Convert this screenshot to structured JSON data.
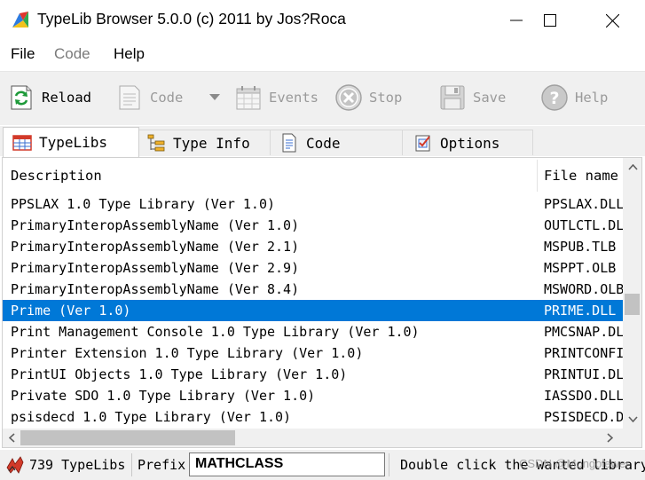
{
  "window": {
    "title": "TypeLib Browser 5.0.0 (c) 2011 by Jos?Roca"
  },
  "menu": [
    {
      "label": "File",
      "enabled": true
    },
    {
      "label": "Code",
      "enabled": false
    },
    {
      "label": "Help",
      "enabled": true
    }
  ],
  "toolbar": {
    "reload": "Reload",
    "code": "Code",
    "events": "Events",
    "stop": "Stop",
    "save": "Save",
    "help": "Help"
  },
  "tabs": [
    {
      "label": "TypeLibs",
      "active": true
    },
    {
      "label": "Type Info",
      "active": false
    },
    {
      "label": "Code",
      "active": false
    },
    {
      "label": "Options",
      "active": false
    }
  ],
  "list": {
    "columns": [
      "Description",
      "File name"
    ],
    "rows": [
      [
        "PPSLAX 1.0 Type Library (Ver 1.0)",
        "PPSLAX.DLL"
      ],
      [
        "PrimaryInteropAssemblyName (Ver 1.0)",
        "OUTLCTL.DLL"
      ],
      [
        "PrimaryInteropAssemblyName (Ver 2.1)",
        "MSPUB.TLB"
      ],
      [
        "PrimaryInteropAssemblyName (Ver 2.9)",
        "MSPPT.OLB"
      ],
      [
        "PrimaryInteropAssemblyName (Ver 8.4)",
        "MSWORD.OLB"
      ],
      [
        "Prime (Ver 1.0)",
        "PRIME.DLL"
      ],
      [
        "Print Management Console 1.0 Type Library (Ver 1.0)",
        "PMCSNAP.DLL"
      ],
      [
        "Printer Extension 1.0 Type Library (Ver 1.0)",
        "PRINTCONFIG.DLL"
      ],
      [
        "PrintUI Objects 1.0 Type Library (Ver 1.0)",
        "PRINTUI.DLL"
      ],
      [
        "Private SDO 1.0 Type Library (Ver 1.0)",
        "IASSDO.DLL"
      ],
      [
        "psisdecd 1.0 Type Library (Ver 1.0)",
        "PSISDECD.DLL"
      ]
    ],
    "selected_index": 5,
    "vertical_scroll_position": 0.55,
    "horizontal_scroll_position": 0.0
  },
  "status": {
    "count": "739 TypeLibs",
    "prefix_label": "Prefix",
    "prefix_value": "MATHCLASS",
    "hint": "Double click the wanted library"
  },
  "watermark": "CSDN @Mongolewer",
  "colors": {
    "selection": "#0078d7",
    "chrome": "#f0f0f0"
  }
}
